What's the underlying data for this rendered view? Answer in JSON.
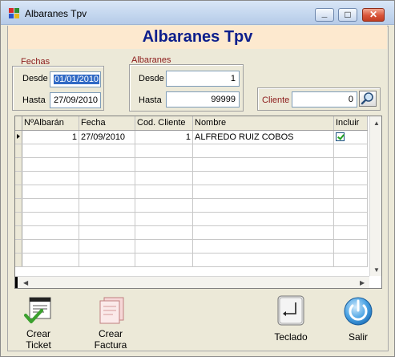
{
  "window": {
    "title": "Albaranes Tpv",
    "buttons": {
      "minimize": "_",
      "maximize": "□",
      "close": "✕"
    }
  },
  "banner": {
    "title": "Albaranes Tpv"
  },
  "fechas": {
    "group_label": "Fechas",
    "desde_label": "Desde",
    "desde_value": "01/01/2010",
    "hasta_label": "Hasta",
    "hasta_value": "27/09/2010"
  },
  "albaranes": {
    "group_label": "Albaranes",
    "desde_label": "Desde",
    "desde_value": "1",
    "hasta_label": "Hasta",
    "hasta_value": "99999"
  },
  "cliente": {
    "label": "Cliente",
    "value": "0"
  },
  "grid": {
    "columns": [
      "NºAlbarán",
      "Fecha",
      "Cod. Cliente",
      "Nombre",
      "Incluir"
    ],
    "rows": [
      {
        "albaran": "1",
        "fecha": "27/09/2010",
        "cod_cliente": "1",
        "nombre": "ALFREDO RUIZ COBOS",
        "incluir": true
      }
    ]
  },
  "toolbar": {
    "crear_ticket": "Crear\nTicket",
    "crear_factura": "Crear\nFactura",
    "teclado": "Teclado",
    "salir": "Salir"
  },
  "colors": {
    "banner_bg": "#fde9cf",
    "banner_text": "#0d1e8c",
    "group_label": "#8b1a1a",
    "selection": "#316ac5"
  }
}
